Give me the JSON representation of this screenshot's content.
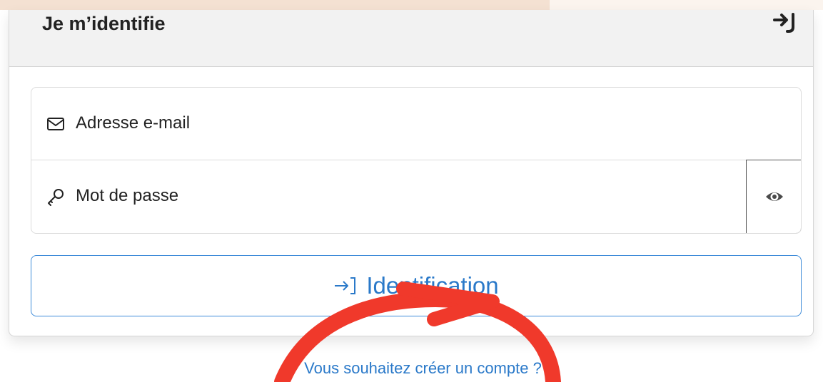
{
  "card": {
    "title": "Je m’identifie",
    "header_icon": "login-arrow-icon"
  },
  "form": {
    "email": {
      "icon": "envelope-icon",
      "placeholder": "Adresse e-mail"
    },
    "password": {
      "icon": "key-icon",
      "placeholder": "Mot de passe",
      "toggle_icon": "eye-icon"
    },
    "submit": {
      "icon": "login-arrow-icon",
      "label": "Identification"
    }
  },
  "footer": {
    "create_account": {
      "icon": "plus-circle-icon",
      "label": "Vous souhaitez créer un compte ?"
    }
  },
  "annotation": {
    "type": "red-curved-arrow",
    "color": "#f0392b"
  },
  "colors": {
    "accent": "#2a79c9",
    "header_bg": "#f2f2f2",
    "top_band": "#f4e1d2"
  }
}
